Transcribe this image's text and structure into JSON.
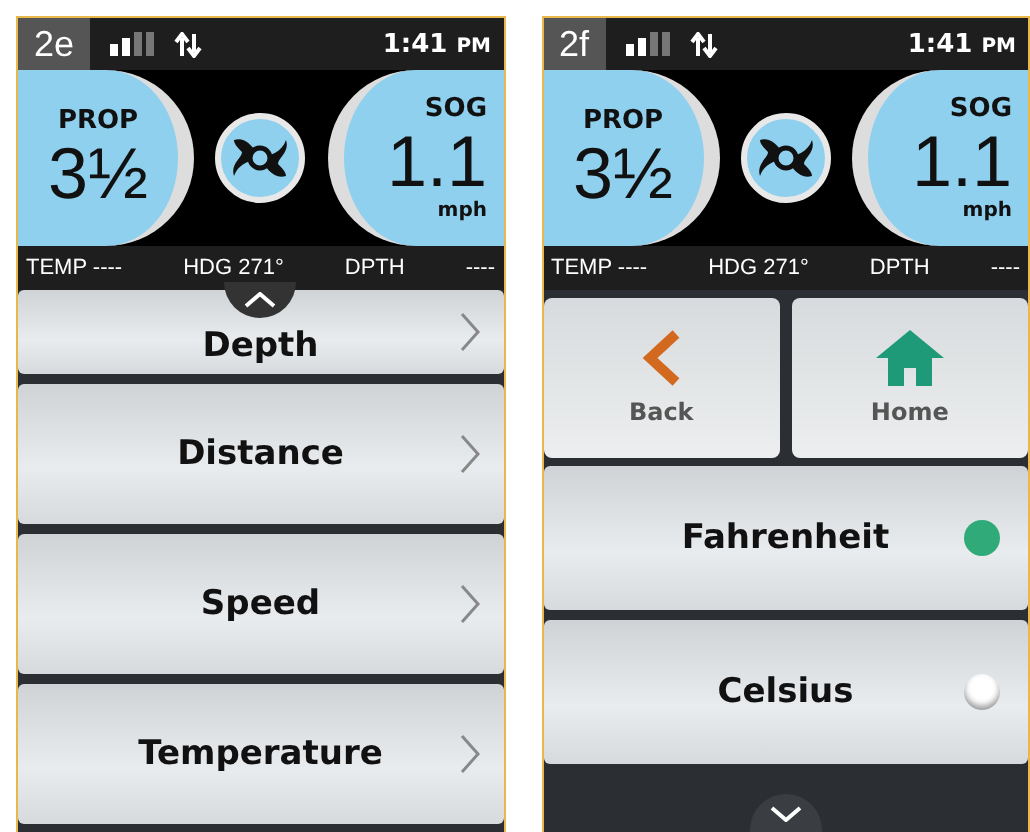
{
  "panels": [
    {
      "label": "2e",
      "time": "1:41",
      "ampm": "PM",
      "prop_label": "PROP",
      "prop_value": "3½",
      "sog_label": "SOG",
      "sog_value": "1.1",
      "sog_unit": "mph",
      "info": [
        "TEMP ----",
        "HDG 271°",
        "DPTH",
        "----"
      ],
      "kind": "menu",
      "items": [
        {
          "label": "Depth"
        },
        {
          "label": "Distance"
        },
        {
          "label": "Speed"
        },
        {
          "label": "Temperature"
        }
      ]
    },
    {
      "label": "2f",
      "time": "1:41",
      "ampm": "PM",
      "prop_label": "PROP",
      "prop_value": "3½",
      "sog_label": "SOG",
      "sog_value": "1.1",
      "sog_unit": "mph",
      "info": [
        "TEMP ----",
        "HDG 271°",
        "DPTH",
        "----"
      ],
      "kind": "options",
      "nav": [
        {
          "label": "Back",
          "kind": "back"
        },
        {
          "label": "Home",
          "kind": "home"
        }
      ],
      "options": [
        {
          "label": "Fahrenheit",
          "selected": true
        },
        {
          "label": "Celsius",
          "selected": false
        }
      ]
    }
  ]
}
